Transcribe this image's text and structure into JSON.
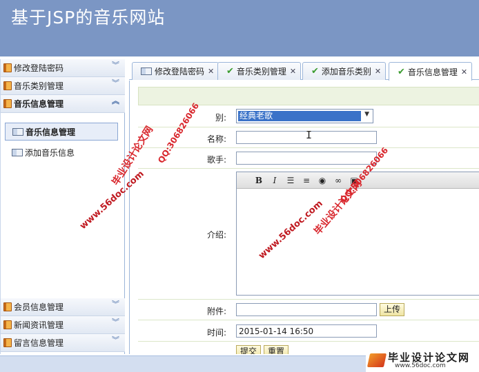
{
  "header": {
    "title": "基于JSP的音乐网站"
  },
  "sidebar": {
    "top_sections": [
      {
        "label": "修改登陆密码"
      },
      {
        "label": "音乐类别管理"
      },
      {
        "label": "音乐信息管理"
      }
    ],
    "open_items": [
      {
        "label": "音乐信息管理"
      },
      {
        "label": "添加音乐信息"
      }
    ],
    "bottom_sections": [
      {
        "label": "会员信息管理"
      },
      {
        "label": "新闻资讯管理"
      },
      {
        "label": "留言信息管理"
      }
    ]
  },
  "tabs": [
    {
      "label": "修改登陆密码"
    },
    {
      "label": "音乐类别管理"
    },
    {
      "label": "添加音乐类别"
    },
    {
      "label": "音乐信息管理"
    }
  ],
  "form": {
    "category_label": "别:",
    "category_value": "经典老歌",
    "name_label": "名称:",
    "singer_label": "歌手:",
    "intro_label": "介绍:",
    "attachment_label": "附件:",
    "upload_button": "上传",
    "time_label": "时间:",
    "time_value": "2015-01-14 16:50",
    "submit_button": "提交",
    "reset_button": "重置"
  },
  "editor_toolbar": [
    "B",
    "I"
  ],
  "watermarks": {
    "brand": "毕业设计论文网",
    "qq": "QQ:306826066",
    "url": "www.56doc.com"
  },
  "footer_logo": {
    "name": "毕业设计论文网",
    "url": "www.56doc.com"
  },
  "colors": {
    "header": "#7b96c4",
    "watermark": "#d8262c",
    "selected": "#3a72c8"
  }
}
